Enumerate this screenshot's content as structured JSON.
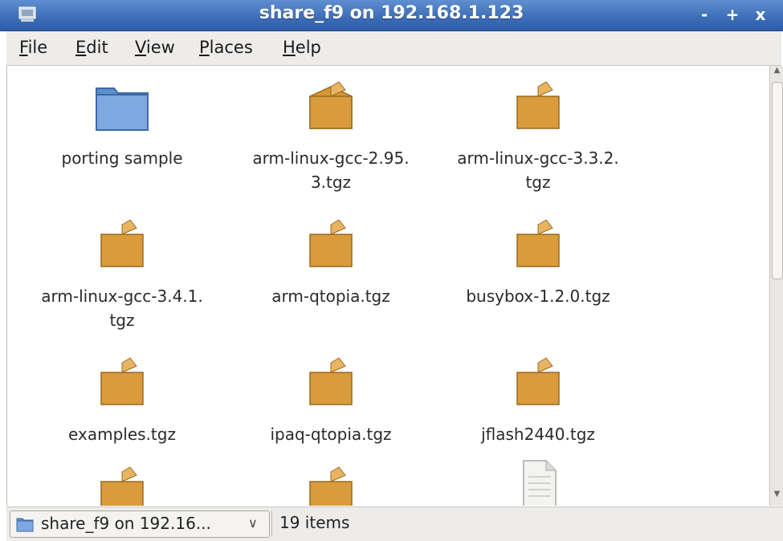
{
  "window": {
    "title": "share_f9 on 192.168.1.123",
    "buttons": [
      "-",
      "+",
      "x"
    ]
  },
  "menubar": [
    {
      "first": "F",
      "rest": "ile"
    },
    {
      "first": "E",
      "rest": "dit"
    },
    {
      "first": "V",
      "rest": "iew"
    },
    {
      "first": "P",
      "rest": "laces"
    },
    {
      "first": "H",
      "rest": "elp"
    }
  ],
  "items": [
    {
      "label": "porting sample",
      "icon": "folder-icon"
    },
    {
      "label": "arm-linux-gcc-2.95.\n3.tgz",
      "icon": "package-icon"
    },
    {
      "label": "arm-linux-gcc-3.3.2.\ntgz",
      "icon": "package-icon"
    },
    {
      "label": "arm-linux-gcc-3.4.1.\ntgz",
      "icon": "package-icon"
    },
    {
      "label": "arm-qtopia.tgz",
      "icon": "package-icon"
    },
    {
      "label": "busybox-1.2.0.tgz",
      "icon": "package-icon"
    },
    {
      "label": "examples.tgz",
      "icon": "package-icon"
    },
    {
      "label": "ipaq-qtopia.tgz",
      "icon": "package-icon"
    },
    {
      "label": "jflash2440.tgz",
      "icon": "package-icon"
    },
    {
      "label": "",
      "icon": "package-icon"
    },
    {
      "label": "",
      "icon": "package-icon"
    },
    {
      "label": "",
      "icon": "text-file-icon"
    }
  ],
  "statusbar": {
    "location": "share_f9 on 192.16...",
    "chevron": "∨",
    "count": "19 items"
  },
  "colors": {
    "titlebar": "#3f6fb8",
    "folder": "#6d9bd6",
    "package": "#d89a3a",
    "menubar": "#edeceb"
  }
}
